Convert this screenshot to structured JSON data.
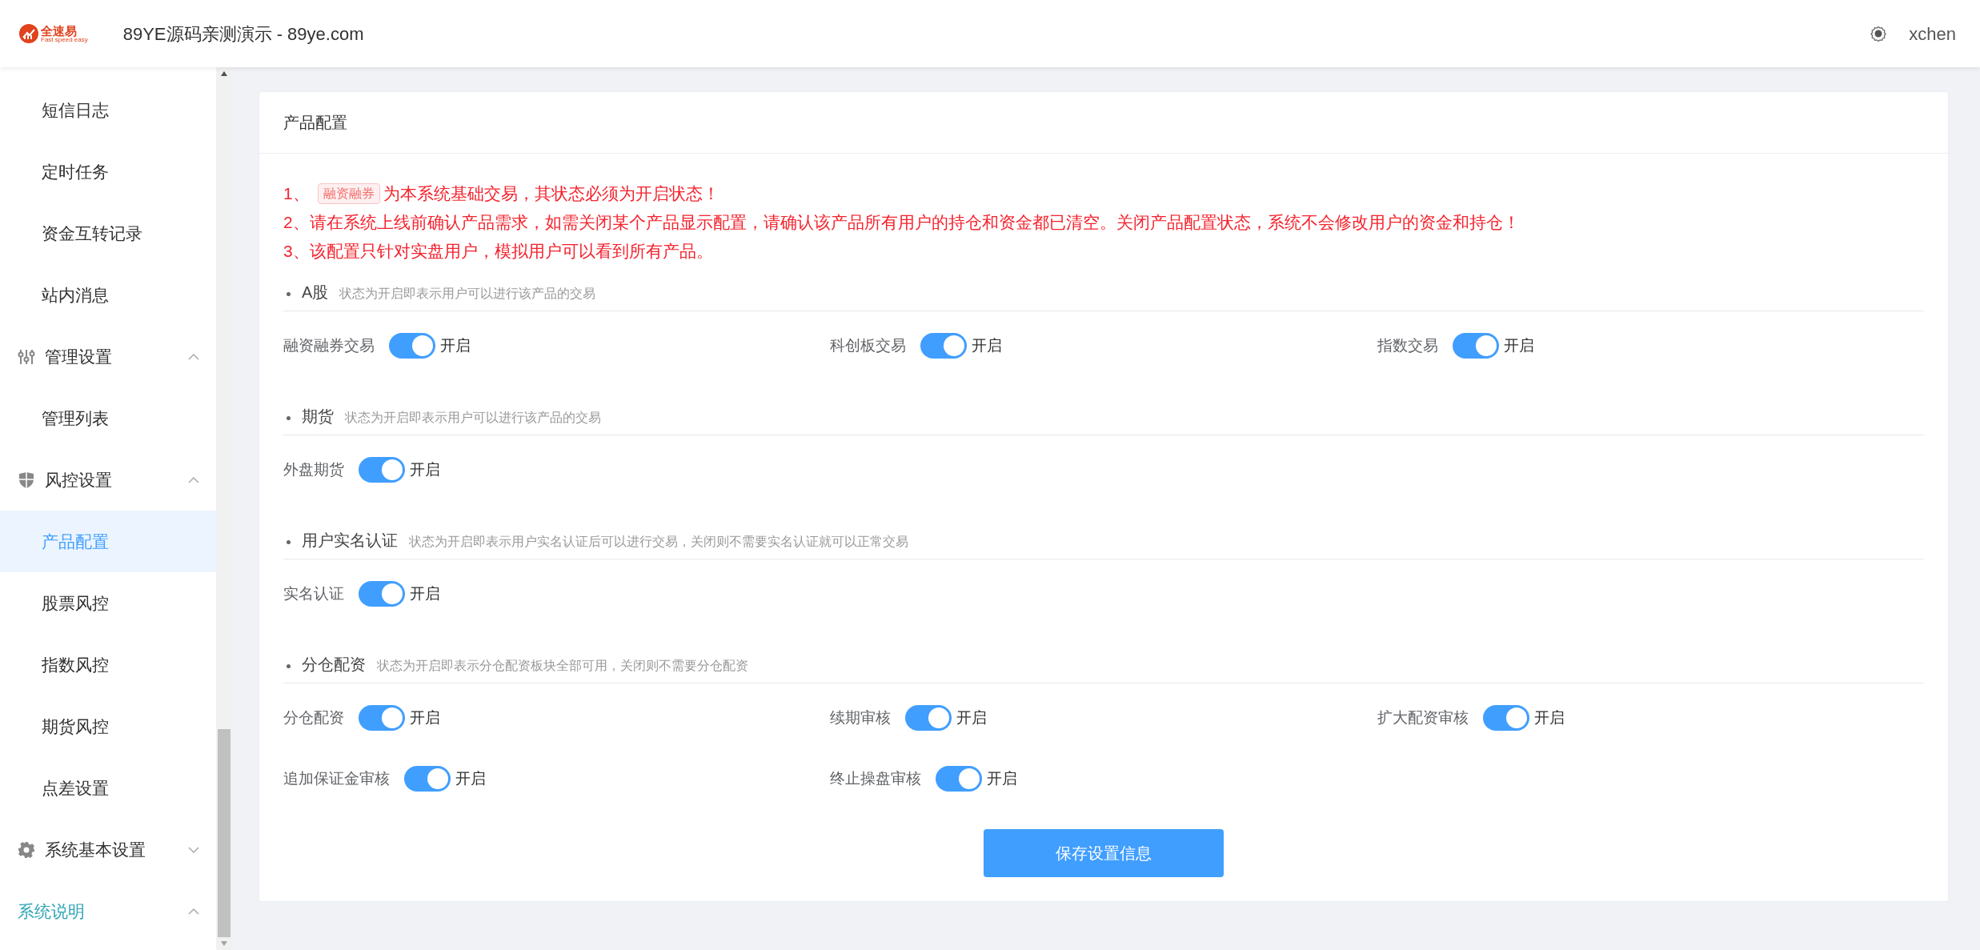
{
  "header": {
    "logo_text": "全速易",
    "logo_tagline": "Fast speed easy",
    "title": "89YE源码亲测演示 - 89ye.com",
    "user": "xchen"
  },
  "sidebar": {
    "items": [
      {
        "kind": "item",
        "label": "短信日志",
        "selected": false
      },
      {
        "kind": "item",
        "label": "定时任务",
        "selected": false
      },
      {
        "kind": "item",
        "label": "资金互转记录",
        "selected": false
      },
      {
        "kind": "item",
        "label": "站内消息",
        "selected": false
      },
      {
        "kind": "group",
        "label": "管理设置",
        "expanded": true,
        "active": false,
        "children": [
          {
            "kind": "item",
            "label": "管理列表",
            "selected": false
          }
        ]
      },
      {
        "kind": "group",
        "label": "风控设置",
        "expanded": true,
        "active": false,
        "children": [
          {
            "kind": "item",
            "label": "产品配置",
            "selected": true
          },
          {
            "kind": "item",
            "label": "股票风控",
            "selected": false
          },
          {
            "kind": "item",
            "label": "指数风控",
            "selected": false
          },
          {
            "kind": "item",
            "label": "期货风控",
            "selected": false
          },
          {
            "kind": "item",
            "label": "点差设置",
            "selected": false
          }
        ]
      },
      {
        "kind": "group",
        "label": "系统基本设置",
        "expanded": false,
        "active": false
      },
      {
        "kind": "group",
        "label": "系统说明",
        "expanded": true,
        "active": true
      }
    ]
  },
  "card": {
    "title": "产品配置",
    "notes": [
      {
        "prefix": "1、",
        "tag": "融资融券",
        "text": "为本系统基础交易，其状态必须为开启状态！"
      },
      {
        "text": "2、请在系统上线前确认产品需求，如需关闭某个产品显示配置，请确认该产品所有用户的持仓和资金都已清空。关闭产品配置状态，系统不会修改用户的资金和持仓！"
      },
      {
        "text": "3、该配置只针对实盘用户，模拟用户可以看到所有产品。"
      }
    ],
    "sections": [
      {
        "title": "A股",
        "hint": "状态为开启即表示用户可以进行该产品的交易",
        "switches": [
          {
            "label": "融资融券交易",
            "on": true,
            "state_text": "开启"
          },
          {
            "label": "科创板交易",
            "on": true,
            "state_text": "开启"
          },
          {
            "label": "指数交易",
            "on": true,
            "state_text": "开启"
          }
        ]
      },
      {
        "title": "期货",
        "hint": "状态为开启即表示用户可以进行该产品的交易",
        "switches": [
          {
            "label": "外盘期货",
            "on": true,
            "state_text": "开启"
          }
        ]
      },
      {
        "title": "用户实名认证",
        "hint": "状态为开启即表示用户实名认证后可以进行交易，关闭则不需要实名认证就可以正常交易",
        "switches": [
          {
            "label": "实名认证",
            "on": true,
            "state_text": "开启"
          }
        ]
      },
      {
        "title": "分仓配资",
        "hint": "状态为开启即表示分仓配资板块全部可用，关闭则不需要分仓配资",
        "switches": [
          {
            "label": "分仓配资",
            "on": true,
            "state_text": "开启"
          },
          {
            "label": "续期审核",
            "on": true,
            "state_text": "开启"
          },
          {
            "label": "扩大配资审核",
            "on": true,
            "state_text": "开启"
          },
          {
            "label": "追加保证金审核",
            "on": true,
            "state_text": "开启"
          },
          {
            "label": "终止操盘审核",
            "on": true,
            "state_text": "开启"
          }
        ]
      }
    ],
    "save_button": "保存设置信息"
  }
}
